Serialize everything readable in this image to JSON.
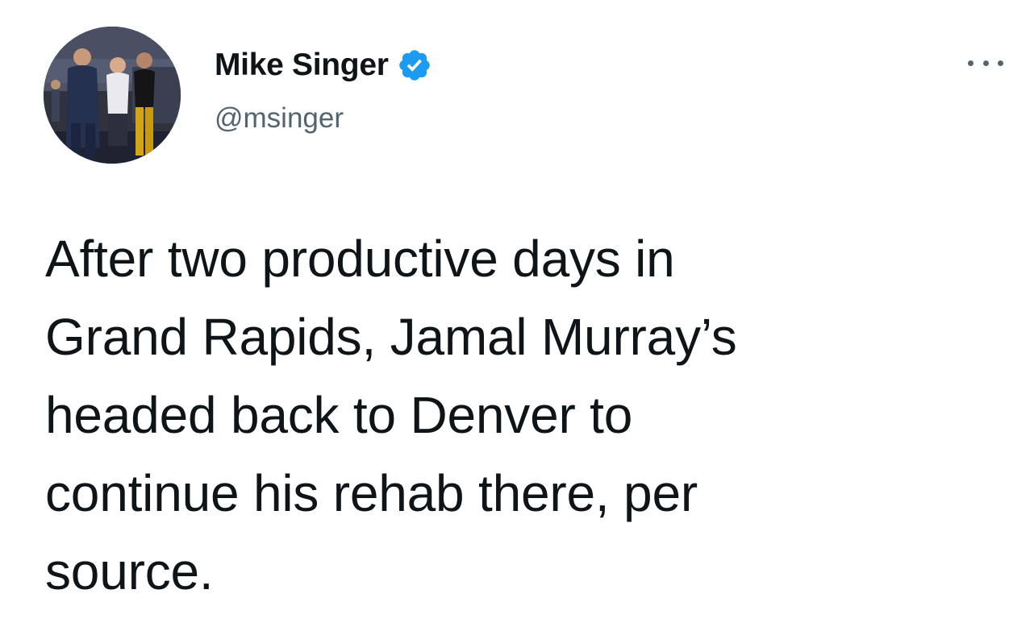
{
  "author": {
    "display_name": "Mike Singer",
    "handle": "@msinger",
    "verified": true,
    "verified_color": "#1d9bf0",
    "avatar_icon": "profile-photo"
  },
  "menu": {
    "icon": "more-horizontal-icon"
  },
  "tweet": {
    "text": "After two productive days in\nGrand Rapids, Jamal Murray’s\nheaded back to Denver to\ncontinue his rehab there, per\nsource."
  },
  "colors": {
    "text": "#0f1419",
    "secondary": "#536471",
    "background": "#ffffff"
  }
}
